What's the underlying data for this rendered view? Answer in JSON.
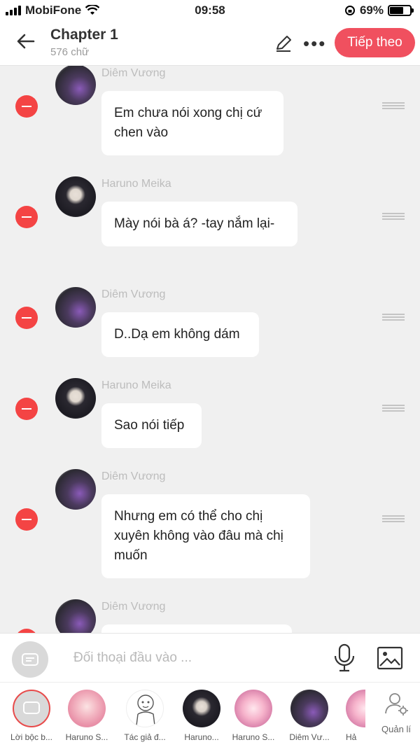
{
  "status": {
    "carrier": "MobiFone",
    "time": "09:58",
    "battery": "69%",
    "battery_level": 0.69
  },
  "header": {
    "title": "Chapter 1",
    "subtitle": "576 chữ",
    "next_label": "Tiếp theo"
  },
  "messages": [
    {
      "name": "Diêm Vương",
      "text": "Em chưa nói xong chị cứ chen vào"
    },
    {
      "name": "Haruno Meika",
      "text": "Mày nói bà á? -tay nắm lại-"
    },
    {
      "name": "Diêm Vương",
      "text": "D..Dạ em không dám"
    },
    {
      "name": "Haruno Meika",
      "text": "Sao nói tiếp"
    },
    {
      "name": "Diêm Vương",
      "text": "Nhưng em có thể cho chị xuyên không vào đâu mà chị muốn"
    },
    {
      "name": "Diêm Vương",
      "text": ""
    }
  ],
  "input": {
    "placeholder": "Đối thoại đầu vào ..."
  },
  "characters": [
    {
      "label": "Lời bộc b...",
      "icon": "narration-icon"
    },
    {
      "label": "Haruno S..."
    },
    {
      "label": "Tác giả đ..."
    },
    {
      "label": "Haruno..."
    },
    {
      "label": "Haruno S..."
    },
    {
      "label": "Diêm Vư..."
    },
    {
      "label": "Hả"
    }
  ],
  "manage_label": "Quản lí",
  "colors": {
    "accent": "#f0505f",
    "remove": "#f44444"
  }
}
